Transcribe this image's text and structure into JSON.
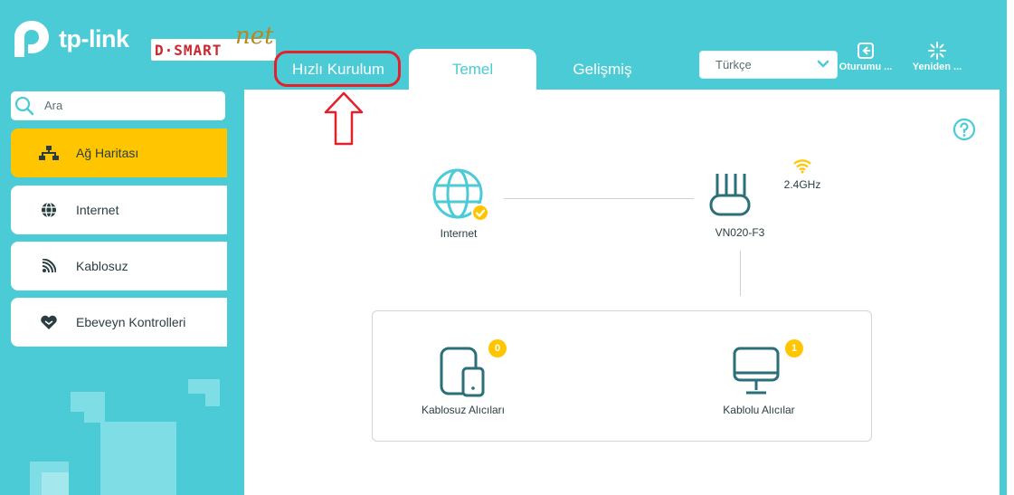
{
  "brand": {
    "name": "tp-link",
    "partner": "D·SMART",
    "partner_suffix": "net"
  },
  "tabs": {
    "quick_setup": "Hızlı Kurulum",
    "basic": "Temel",
    "advanced": "Gelişmiş"
  },
  "language": {
    "selected": "Türkçe"
  },
  "header_buttons": {
    "logout": "Oturumu ...",
    "reboot": "Yeniden ..."
  },
  "search": {
    "placeholder": "Ara"
  },
  "sidebar": {
    "items": [
      {
        "label": "Ağ Haritası",
        "icon": "network-map-icon",
        "active": true
      },
      {
        "label": "Internet",
        "icon": "globe-icon",
        "active": false
      },
      {
        "label": "Kablosuz",
        "icon": "wifi-icon",
        "active": false
      },
      {
        "label": "Ebeveyn Kontrolleri",
        "icon": "heart-icon",
        "active": false
      }
    ]
  },
  "network_map": {
    "internet_label": "Internet",
    "router_label": "VN020-F3",
    "band": "2.4GHz",
    "wireless_clients": {
      "label": "Kablosuz Alıcıları",
      "count": "0"
    },
    "wired_clients": {
      "label": "Kablolu Alıcılar",
      "count": "1"
    }
  },
  "colors": {
    "accent": "#4acbd6",
    "active": "#ffc600",
    "highlight": "#e4202a",
    "text": "#2a3e42",
    "icon": "#2b6f78"
  }
}
